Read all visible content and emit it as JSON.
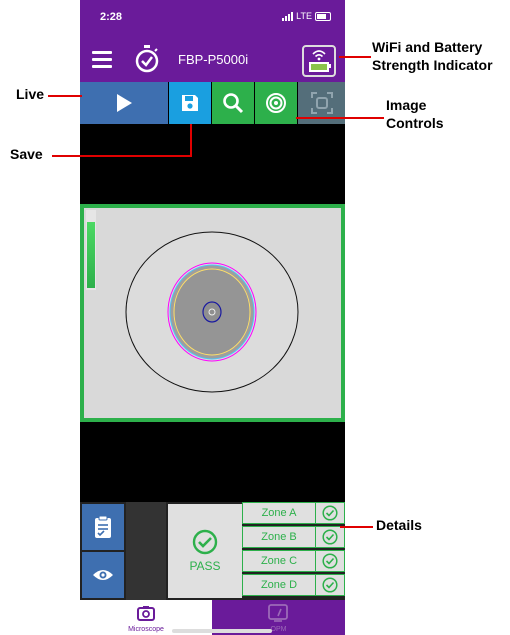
{
  "status_bar": {
    "time": "2:28",
    "network": "LTE"
  },
  "app_bar": {
    "title": "FBP-P5000i"
  },
  "toolbar": {
    "buttons": [
      {
        "name": "live",
        "color": "#3e6fb0"
      },
      {
        "name": "save",
        "color": "#1a9fe0"
      },
      {
        "name": "zoom",
        "color": "#2db04b"
      },
      {
        "name": "focus-target",
        "color": "#2db04b"
      },
      {
        "name": "auto-capture",
        "color": "#546e7a"
      }
    ]
  },
  "results": {
    "status": "PASS",
    "zones": [
      {
        "label": "Zone A"
      },
      {
        "label": "Zone B"
      },
      {
        "label": "Zone C"
      },
      {
        "label": "Zone D"
      }
    ]
  },
  "bottom_nav": {
    "microscope": "Microscope",
    "opm": "OPM"
  },
  "callouts": {
    "wifi": "WiFi and Battery Strength Indicator",
    "live": "Live",
    "image_controls": "Image Controls",
    "save": "Save",
    "details": "Details"
  },
  "colors": {
    "brand_purple": "#6a1b9a",
    "pass_green": "#2db04b",
    "annotation_red": "#e00000"
  }
}
